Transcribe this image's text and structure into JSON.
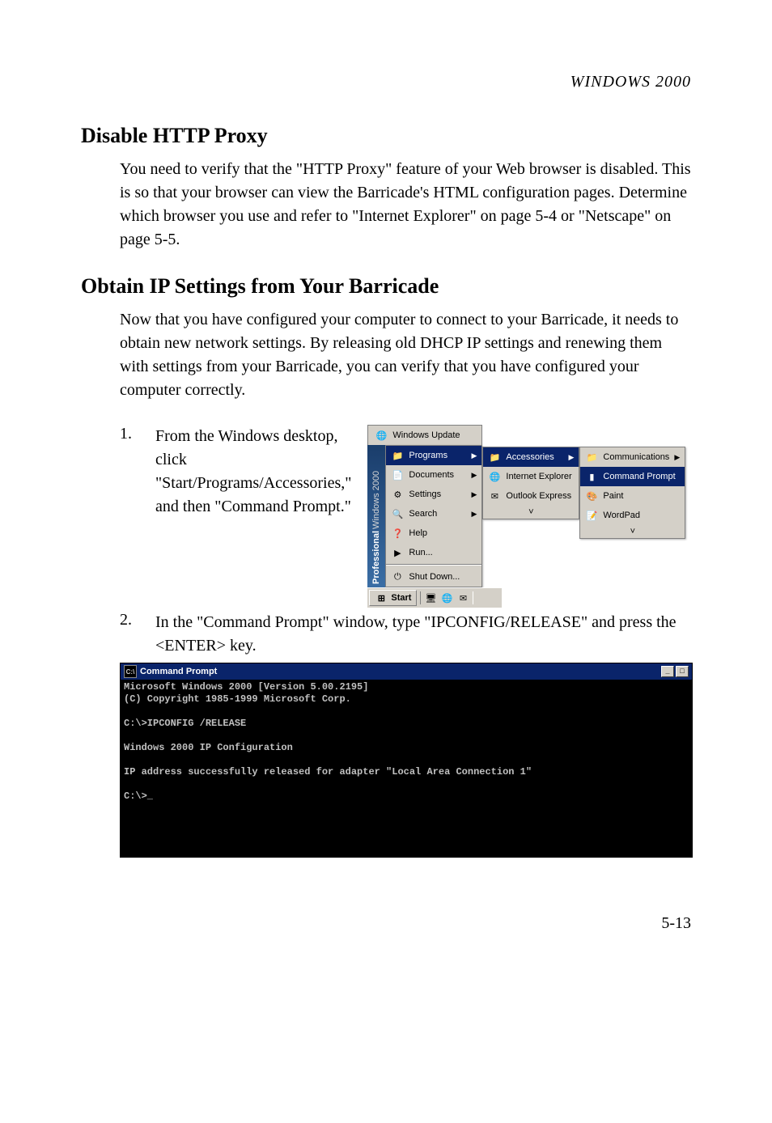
{
  "header": "WINDOWS 2000",
  "h1": "Disable HTTP Proxy",
  "p1": "You need to verify that the \"HTTP Proxy\" feature of your Web browser is disabled. This is so that your browser can view the Barricade's HTML configuration pages. Determine which browser you use and refer to \"Internet Explorer\" on page 5-4 or \"Netscape\" on page 5-5.",
  "h2": "Obtain IP Settings from Your Barricade",
  "p2": "Now that you have configured your computer to connect to your Barricade, it needs to obtain new network settings. By releasing old DHCP IP settings and renewing them with settings from your Barricade, you can verify that you have configured your computer correctly.",
  "step1_num": "1.",
  "step1_text": "From the Windows desktop, click \"Start/Programs/Accessories,\" and then \"Command Prompt.\"",
  "step2_num": "2.",
  "step2_text": "In the \"Command Prompt\" window, type \"IPCONFIG/RELEASE\" and press the <ENTER> key.",
  "start_menu": {
    "band_pro": "Professional",
    "band_w2k": "Windows 2000",
    "top": "Windows Update",
    "items": [
      {
        "label": "Programs",
        "arrow": true,
        "hl": true
      },
      {
        "label": "Documents",
        "arrow": true
      },
      {
        "label": "Settings",
        "arrow": true
      },
      {
        "label": "Search",
        "arrow": true
      },
      {
        "label": "Help"
      },
      {
        "label": "Run..."
      },
      {
        "label": "Shut Down..."
      }
    ],
    "sub1": [
      {
        "label": "Accessories",
        "arrow": true,
        "hl": true
      },
      {
        "label": "Internet Explorer"
      },
      {
        "label": "Outlook Express"
      }
    ],
    "sub2": [
      {
        "label": "Communications",
        "arrow": true
      },
      {
        "label": "Command Prompt",
        "hl": true
      },
      {
        "label": "Paint"
      },
      {
        "label": "WordPad"
      }
    ],
    "start_label": "Start",
    "chevron": "˅"
  },
  "cmd": {
    "title": "Command Prompt",
    "lines": "Microsoft Windows 2000 [Version 5.00.2195]\n(C) Copyright 1985-1999 Microsoft Corp.\n\nC:\\>IPCONFIG /RELEASE\n\nWindows 2000 IP Configuration\n\nIP address successfully released for adapter \"Local Area Connection 1\"\n\nC:\\>_"
  },
  "page_num": "5-13"
}
